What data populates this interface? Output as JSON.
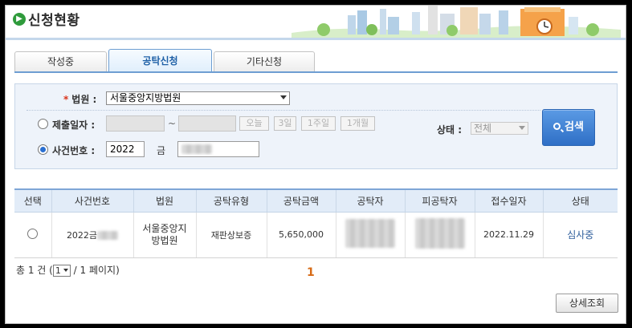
{
  "header": {
    "title": "신청현황"
  },
  "tabs": [
    {
      "label": "작성중"
    },
    {
      "label": "공탁신청"
    },
    {
      "label": "기타신청"
    }
  ],
  "search": {
    "court_label": "법원 :",
    "court_value": "서울중앙지방법원",
    "date_label": "제출일자 :",
    "date_separator": "~",
    "quick_buttons": [
      "오늘",
      "3일",
      "1주일",
      "1개월"
    ],
    "status_label": "상태 :",
    "status_value": "전체",
    "case_label": "사건번호 :",
    "case_year": "2022",
    "case_type": "금",
    "search_button": "검색"
  },
  "table": {
    "headers": [
      "선택",
      "사건번호",
      "법원",
      "공탁유형",
      "공탁금액",
      "공탁자",
      "피공탁자",
      "접수일자",
      "상태"
    ],
    "rows": [
      {
        "case_no": "2022금",
        "court": "서울중앙지방법원",
        "type": "재판상보증",
        "amount": "5,650,000",
        "received": "2022.11.29",
        "status": "심사중"
      }
    ]
  },
  "pagination": {
    "total_prefix": "총 1 건 (",
    "current_page": "1",
    "total_suffix": "/ 1 페이지)",
    "page_link": "1"
  },
  "detail_button": "상세조회"
}
